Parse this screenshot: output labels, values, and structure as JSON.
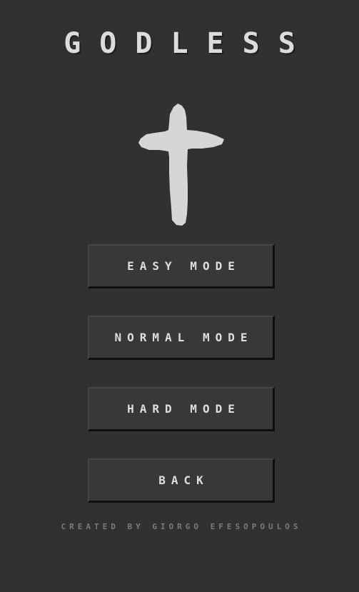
{
  "app": {
    "title": "GODLESS",
    "emblem_icon": "cross-icon"
  },
  "menu": {
    "buttons": [
      {
        "label": "EASY MODE"
      },
      {
        "label": "NORMAL MODE"
      },
      {
        "label": "HARD MODE"
      },
      {
        "label": "BACK"
      }
    ]
  },
  "footer": {
    "credits": "CREATED BY GIORGO EFESOPOULOS"
  },
  "colors": {
    "background": "#313131",
    "button": "#383838",
    "text": "#dedede",
    "muted_text": "#7a7a7a"
  }
}
